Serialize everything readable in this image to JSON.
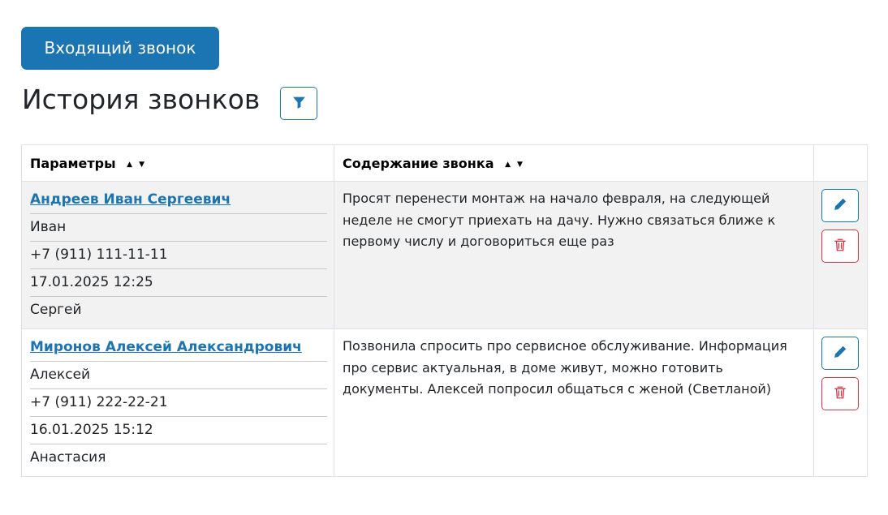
{
  "toolbar": {
    "incoming_call_label": "Входящий звонок"
  },
  "page": {
    "title": "История звонков"
  },
  "icons": {
    "filter": "filter-icon",
    "edit": "pencil-icon",
    "delete": "trash-icon"
  },
  "colors": {
    "primary": "#1b75b3",
    "danger": "#dc3545",
    "row_shade": "#f2f2f2"
  },
  "table": {
    "columns": [
      {
        "label": "Параметры",
        "sort_asc": "▲",
        "sort_desc": "▼"
      },
      {
        "label": "Содержание звонка",
        "sort_asc": "▲",
        "sort_desc": "▼"
      },
      {
        "label": ""
      }
    ],
    "rows": [
      {
        "client_name": "Андреев Иван Сергеевич",
        "contact_name": "Иван",
        "phone": "+7 (911) 111-11-11",
        "datetime": "17.01.2025 12:25",
        "manager": "Сергей",
        "content": "Просят перенести монтаж на начало февраля, на следующей неделе не смогут приехать на дачу. Нужно связаться ближе к первому числу и договориться еще раз"
      },
      {
        "client_name": "Миронов Алексей Александрович",
        "contact_name": "Алексей",
        "phone": "+7 (911) 222-22-21",
        "datetime": "16.01.2025 15:12",
        "manager": "Анастасия",
        "content": "Позвонила спросить про сервисное обслуживание. Информация про сервис актуальная, в доме живут, можно готовить документы. Алексей попросил общаться с женой (Светланой)"
      }
    ]
  }
}
